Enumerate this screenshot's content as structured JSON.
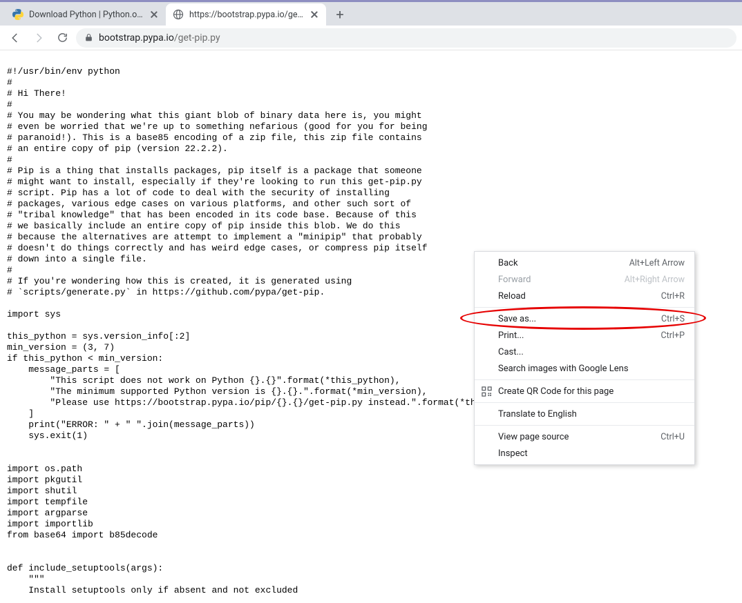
{
  "tabs": [
    {
      "title": "Download Python | Python.org",
      "active": false,
      "favicon": "python"
    },
    {
      "title": "https://bootstrap.pypa.io/get-pip",
      "active": true,
      "favicon": "globe"
    }
  ],
  "newtab_glyph": "+",
  "omnibox": {
    "host": "bootstrap.pypa.io",
    "path": "/get-pip.py"
  },
  "page_text": "#!/usr/bin/env python\n#\n# Hi There!\n#\n# You may be wondering what this giant blob of binary data here is, you might\n# even be worried that we're up to something nefarious (good for you for being\n# paranoid!). This is a base85 encoding of a zip file, this zip file contains\n# an entire copy of pip (version 22.2.2).\n#\n# Pip is a thing that installs packages, pip itself is a package that someone\n# might want to install, especially if they're looking to run this get-pip.py\n# script. Pip has a lot of code to deal with the security of installing\n# packages, various edge cases on various platforms, and other such sort of\n# \"tribal knowledge\" that has been encoded in its code base. Because of this\n# we basically include an entire copy of pip inside this blob. We do this\n# because the alternatives are attempt to implement a \"minipip\" that probably\n# doesn't do things correctly and has weird edge cases, or compress pip itself\n# down into a single file.\n#\n# If you're wondering how this is created, it is generated using\n# `scripts/generate.py` in https://github.com/pypa/get-pip.\n\nimport sys\n\nthis_python = sys.version_info[:2]\nmin_version = (3, 7)\nif this_python < min_version:\n    message_parts = [\n        \"This script does not work on Python {}.{}\".format(*this_python),\n        \"The minimum supported Python version is {}.{}.\".format(*min_version),\n        \"Please use https://bootstrap.pypa.io/pip/{}.{}/get-pip.py instead.\".format(*this_python),\n    ]\n    print(\"ERROR: \" + \" \".join(message_parts))\n    sys.exit(1)\n\n\nimport os.path\nimport pkgutil\nimport shutil\nimport tempfile\nimport argparse\nimport importlib\nfrom base64 import b85decode\n\n\ndef include_setuptools(args):\n    \"\"\"\n    Install setuptools only if absent and not excluded",
  "context_menu": {
    "groups": [
      [
        {
          "label": "Back",
          "shortcut": "Alt+Left Arrow",
          "disabled": false
        },
        {
          "label": "Forward",
          "shortcut": "Alt+Right Arrow",
          "disabled": true
        },
        {
          "label": "Reload",
          "shortcut": "Ctrl+R",
          "disabled": false
        }
      ],
      [
        {
          "label": "Save as...",
          "shortcut": "Ctrl+S",
          "disabled": false
        },
        {
          "label": "Print...",
          "shortcut": "Ctrl+P",
          "disabled": false
        },
        {
          "label": "Cast...",
          "shortcut": "",
          "disabled": false
        },
        {
          "label": "Search images with Google Lens",
          "shortcut": "",
          "disabled": false
        }
      ],
      [
        {
          "label": "Create QR Code for this page",
          "shortcut": "",
          "disabled": false,
          "icon": "qr"
        }
      ],
      [
        {
          "label": "Translate to English",
          "shortcut": "",
          "disabled": false
        }
      ],
      [
        {
          "label": "View page source",
          "shortcut": "Ctrl+U",
          "disabled": false
        },
        {
          "label": "Inspect",
          "shortcut": "",
          "disabled": false
        }
      ]
    ]
  }
}
